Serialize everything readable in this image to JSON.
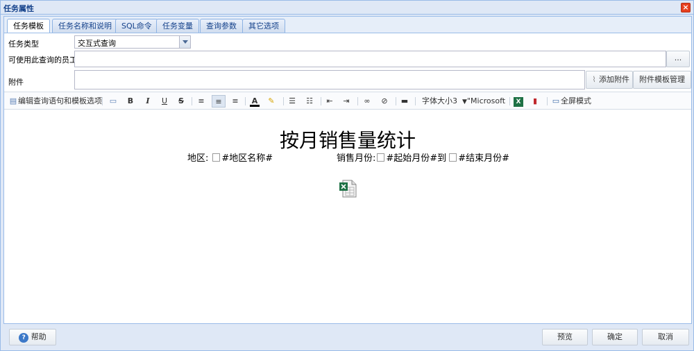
{
  "window": {
    "title": "任务属性"
  },
  "tabs": [
    {
      "label": "任务模板",
      "active": true
    },
    {
      "label": "任务名称和说明",
      "active": false
    },
    {
      "label": "SQL命令",
      "active": false
    },
    {
      "label": "任务变量",
      "active": false
    },
    {
      "label": "查询参数",
      "active": false
    },
    {
      "label": "其它选项",
      "active": false
    }
  ],
  "form": {
    "task_type_label": "任务类型",
    "task_type_value": "交互式查询",
    "employees_label": "可使用此查询的员工",
    "employees_button": "...",
    "attachment_label": "附件",
    "add_attachment": "添加附件",
    "manage_templates": "附件模板管理"
  },
  "toolbar": {
    "edit_options": "编辑查询语句和模板选项",
    "font_size": "字体大小3",
    "font_name": "\"Microsoft Ya",
    "fullscreen": "全屏模式"
  },
  "document": {
    "title": "按月销售量统计",
    "region_label": "地区:",
    "region_var": "#地区名称#",
    "month_label": "销售月份:",
    "start_var": "#起始月份#到",
    "end_var": "#结束月份#"
  },
  "footer": {
    "help": "帮助",
    "preview": "预览",
    "ok": "确定",
    "cancel": "取消"
  },
  "colors": {
    "accent": "#15428b",
    "border": "#99bbe8",
    "excel_green": "#1e7145"
  }
}
